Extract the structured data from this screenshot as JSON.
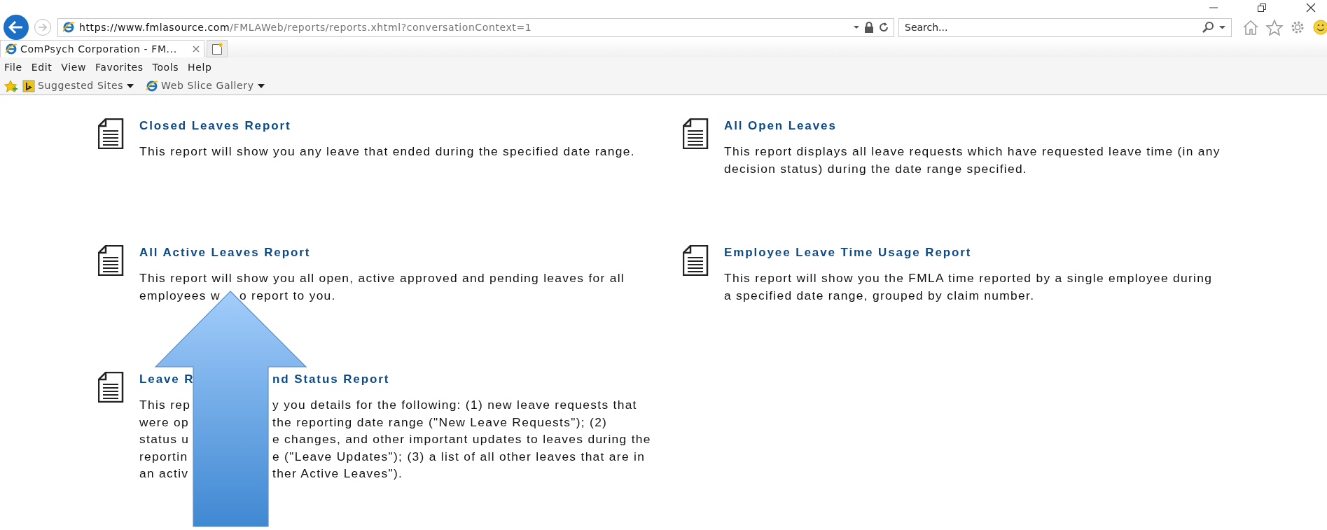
{
  "address_bar": {
    "url_host": "https://www.fmlasource.com",
    "url_path": "/FMLAWeb/reports/reports.xhtml?conversationContext=1"
  },
  "search": {
    "placeholder": "Search..."
  },
  "tabs": [
    {
      "label": "ComPsych Corporation - FM...",
      "selected": true
    }
  ],
  "menu": [
    "File",
    "Edit",
    "View",
    "Favorites",
    "Tools",
    "Help"
  ],
  "favorites": [
    {
      "label": "Suggested Sites"
    },
    {
      "label": "Web Slice Gallery"
    }
  ],
  "reports": [
    {
      "title": {
        "left": "Closed Leaves Report"
      },
      "lines": [
        {
          "left": "This report will show you any leave that ended during the specified date range."
        }
      ]
    },
    {
      "title": {
        "left": "All Open Leaves"
      },
      "lines": [
        {
          "left": "This report displays all leave requests which have requested leave time (in any"
        },
        {
          "left": "decision status) during the date range specified."
        }
      ]
    },
    {
      "title": {
        "left": "All Active Leaves Report"
      },
      "lines": [
        {
          "left": "This report will show you all open, active approved and pending leaves for all"
        },
        {
          "left": "employees w",
          "right": "o report to you."
        }
      ]
    },
    {
      "title": {
        "left": "Employee Leave Time Usage Report"
      },
      "lines": [
        {
          "left": "This report will show you the FMLA time reported by a single employee during"
        },
        {
          "left": "a specified date range, grouped by claim number."
        }
      ]
    },
    {
      "title": {
        "left": "Leave R",
        "right": "nd Status Report"
      },
      "lines": [
        {
          "left": "This rep",
          "right": "y you details for the following: (1) new leave requests that"
        },
        {
          "left": "were op",
          "right": "the reporting date range (\"New Leave Requests\"); (2)"
        },
        {
          "left": "status u",
          "right": "e changes, and other important updates to leaves during the"
        },
        {
          "left": "reportin",
          "right": "e (\"Leave Updates\"); (3) a list of all other leaves that are in"
        },
        {
          "left": "an activ",
          "right": "ther Active Leaves\")."
        }
      ]
    }
  ]
}
